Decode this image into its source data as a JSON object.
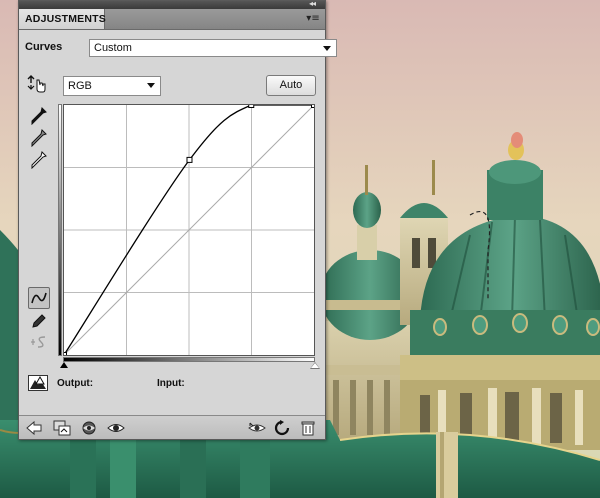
{
  "panel": {
    "tab_label": "ADJUSTMENTS",
    "collapse_glyph": "◂◂",
    "menu_glyph": "▾≡"
  },
  "curves": {
    "label": "Curves",
    "preset_value": "Custom",
    "channel_value": "RGB",
    "auto_label": "Auto",
    "output_label": "Output:",
    "input_label": "Input:",
    "curve_points": [
      [
        0,
        0
      ],
      [
        128,
        199
      ],
      [
        191,
        255
      ],
      [
        255,
        255
      ]
    ]
  },
  "tools": {
    "left": [
      "hand-target-icon",
      "black-eyedropper-icon",
      "gray-eyedropper-icon",
      "white-eyedropper-icon",
      "curve-mode-icon",
      "pencil-icon",
      "smooth-icon",
      "clipping-warning-icon"
    ],
    "bottom": [
      "back-arrow-icon",
      "clip-layer-icon",
      "visibility-toggle-icon",
      "eye-icon",
      "view-previous-icon",
      "reset-icon",
      "trash-icon"
    ]
  },
  "colors": {
    "panel_bg": "#d6d6d6",
    "tab_active": "#dedede",
    "dome_green": "#3f8a6e",
    "sky_top": "#d8bfb7"
  }
}
